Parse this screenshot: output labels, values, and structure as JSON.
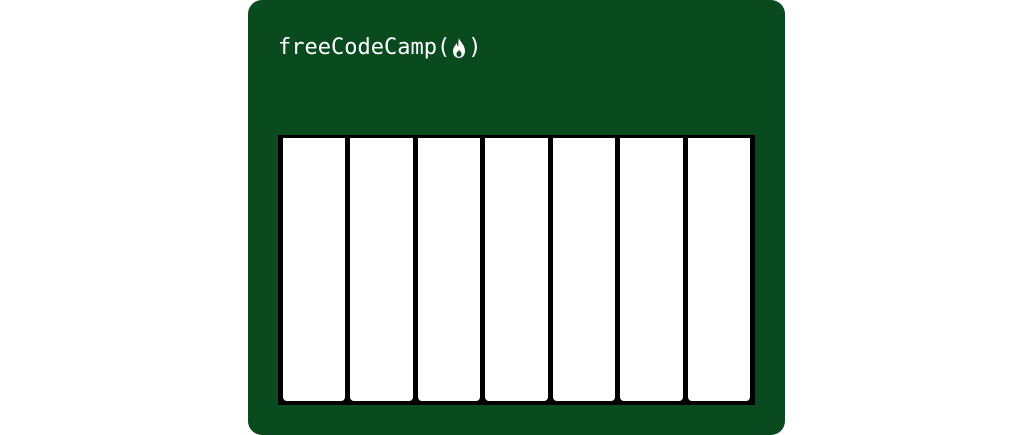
{
  "brand": {
    "name": "freeCodeCamp",
    "open_paren": "(",
    "close_paren": ")",
    "icon": "flame-icon"
  },
  "diagram": {
    "keys": [
      {
        "color": "#ffffff"
      },
      {
        "color": "#ffffff"
      },
      {
        "color": "#ffffff"
      },
      {
        "color": "#ffffff"
      },
      {
        "color": "#ffffff"
      },
      {
        "color": "#ffffff"
      },
      {
        "color": "#ffffff"
      }
    ]
  },
  "colors": {
    "card_background": "#0a4a1f",
    "key_frame": "#000000",
    "key_fill": "#ffffff"
  }
}
